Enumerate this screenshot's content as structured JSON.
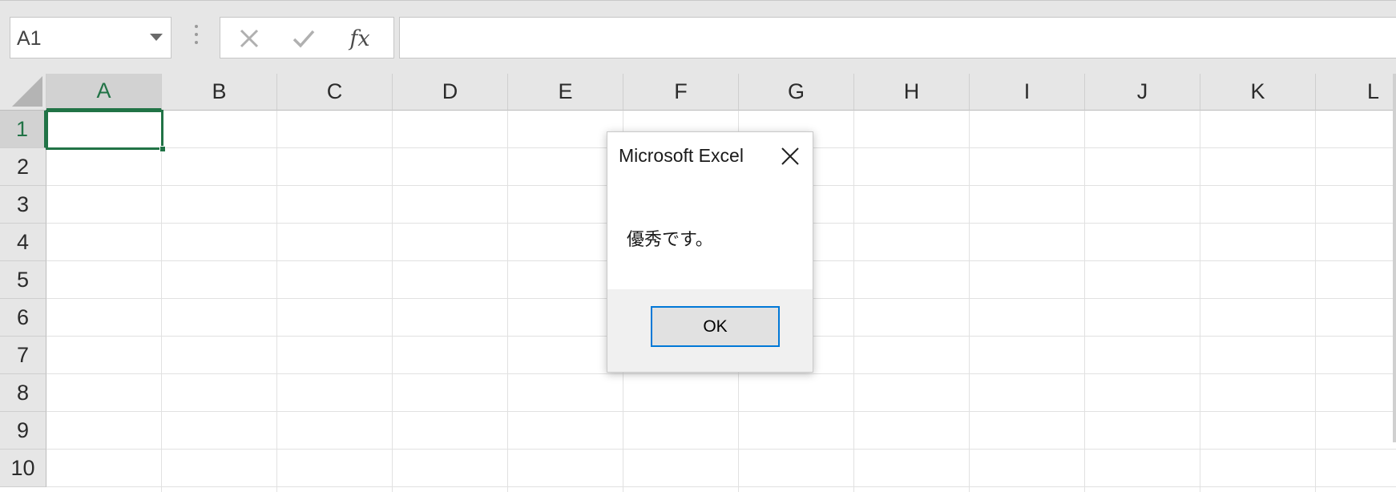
{
  "formula_bar": {
    "name_box_value": "A1",
    "cancel_icon": "close-icon",
    "enter_icon": "check-icon",
    "function_label": "fx",
    "formula_value": ""
  },
  "columns": [
    "A",
    "B",
    "C",
    "D",
    "E",
    "F",
    "G",
    "H",
    "I",
    "J",
    "K",
    "L"
  ],
  "rows": [
    "1",
    "2",
    "3",
    "4",
    "5",
    "6",
    "7",
    "8",
    "9",
    "10"
  ],
  "selected_cell": "A1",
  "colors": {
    "selection_green": "#217346",
    "button_focus_blue": "#0078d7"
  },
  "dialog": {
    "title": "Microsoft Excel",
    "message": "優秀です。",
    "ok_label": "OK"
  }
}
